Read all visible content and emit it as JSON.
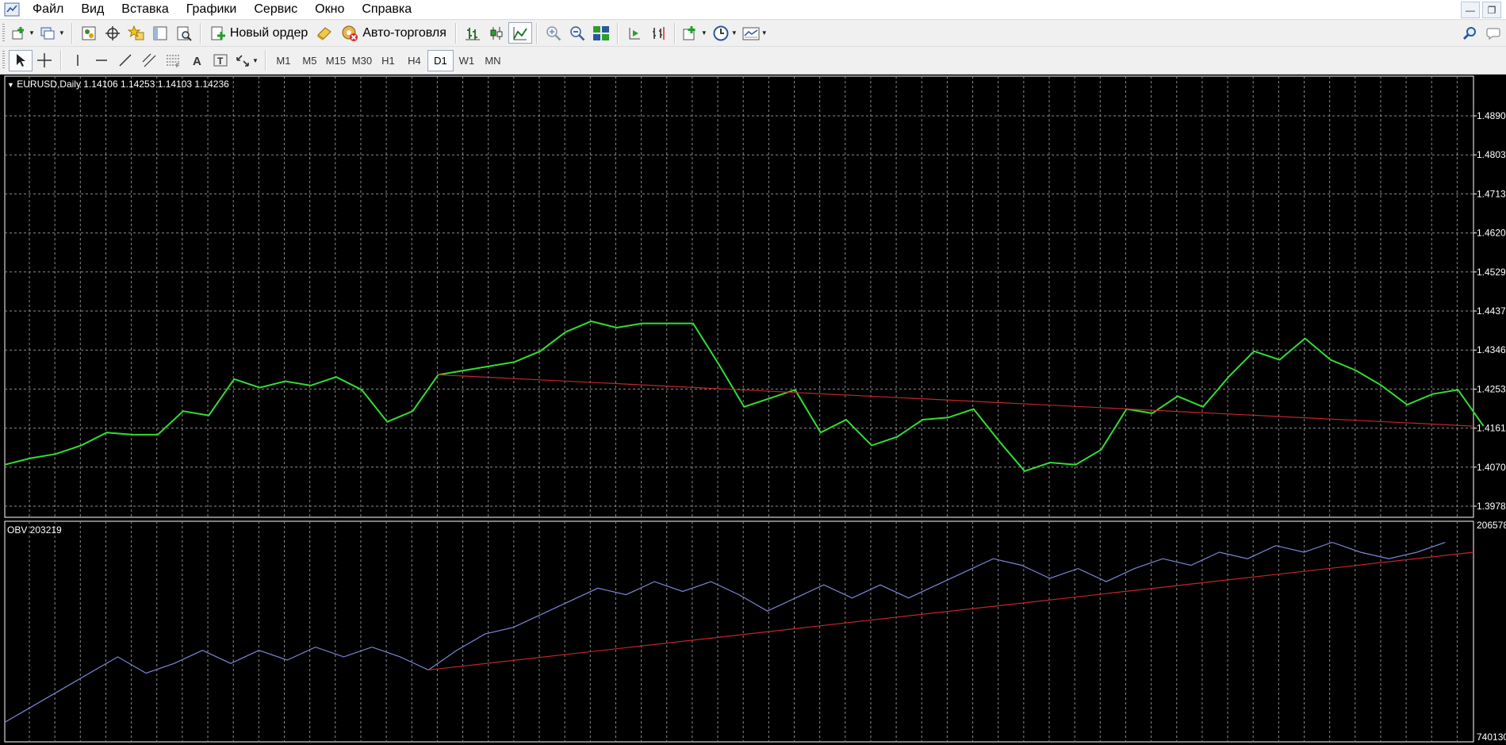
{
  "menu": [
    "Файл",
    "Вид",
    "Вставка",
    "Графики",
    "Сервис",
    "Окно",
    "Справка"
  ],
  "toolbar": {
    "new_order": "Новый ордер",
    "auto_trading": "Авто-торговля"
  },
  "timeframes": [
    "M1",
    "M5",
    "M15",
    "M30",
    "H1",
    "H4",
    "D1",
    "W1",
    "MN"
  ],
  "active_timeframe": "D1",
  "chart": {
    "header": "EURUSD,Daily  1.14106 1.14253 1.14103 1.14236",
    "price_labels": [
      "1.4890",
      "1.4803",
      "1.4713",
      "1.4620",
      "1.4529",
      "1.4437",
      "1.4346",
      "1.4253",
      "1.4161",
      "1.4070",
      "1.3978"
    ],
    "obv_header": "OBV 203219",
    "obv_labels": [
      "206578",
      "740130"
    ],
    "colors": {
      "background": "#000000",
      "price_line": "#33dd33",
      "obv_line": "#7b86d6",
      "trend_line": "#c0262a",
      "grid": "#8a8a8a"
    }
  },
  "chart_data": [
    {
      "type": "line",
      "series": [
        {
          "values": [
            1.4075,
            1.409,
            1.41,
            1.412,
            1.415,
            1.4145,
            1.4145,
            1.42,
            1.419,
            1.4275,
            1.4255,
            1.427,
            1.426,
            1.428,
            1.425,
            1.4175,
            1.42,
            1.4285,
            1.4295,
            1.4305,
            1.4315,
            1.434,
            1.4385,
            1.441,
            1.4395,
            1.4405,
            1.4405,
            1.4405,
            1.431,
            1.421,
            1.423,
            1.425,
            1.415,
            1.418,
            1.412,
            1.414,
            1.418,
            1.4185,
            1.4205,
            1.413,
            1.406,
            1.408,
            1.4075,
            1.411,
            1.4205,
            1.4195,
            1.4235,
            1.421,
            1.428,
            1.434,
            1.432,
            1.437,
            1.432,
            1.4295,
            1.426,
            1.4215,
            1.424,
            1.425,
            1.4165
          ]
        },
        {
          "values": [
            1.4285,
            1.4165
          ]
        }
      ]
    },
    {
      "type": "line",
      "series": [
        {
          "values": [
            180,
            185,
            190,
            195,
            200,
            195,
            198,
            202,
            198,
            202,
            199,
            203,
            200,
            203,
            200,
            196,
            202,
            207,
            209,
            213,
            217,
            221,
            219,
            223,
            220,
            223,
            219,
            214,
            218,
            222,
            218,
            222,
            218,
            222,
            226,
            230,
            228,
            224,
            227,
            223,
            227,
            230,
            228,
            232,
            230,
            234,
            232,
            235,
            232,
            230,
            232,
            235
          ],
          "ylim": [
            175,
            240
          ]
        },
        {
          "values": [
            196,
            232
          ]
        }
      ]
    }
  ]
}
